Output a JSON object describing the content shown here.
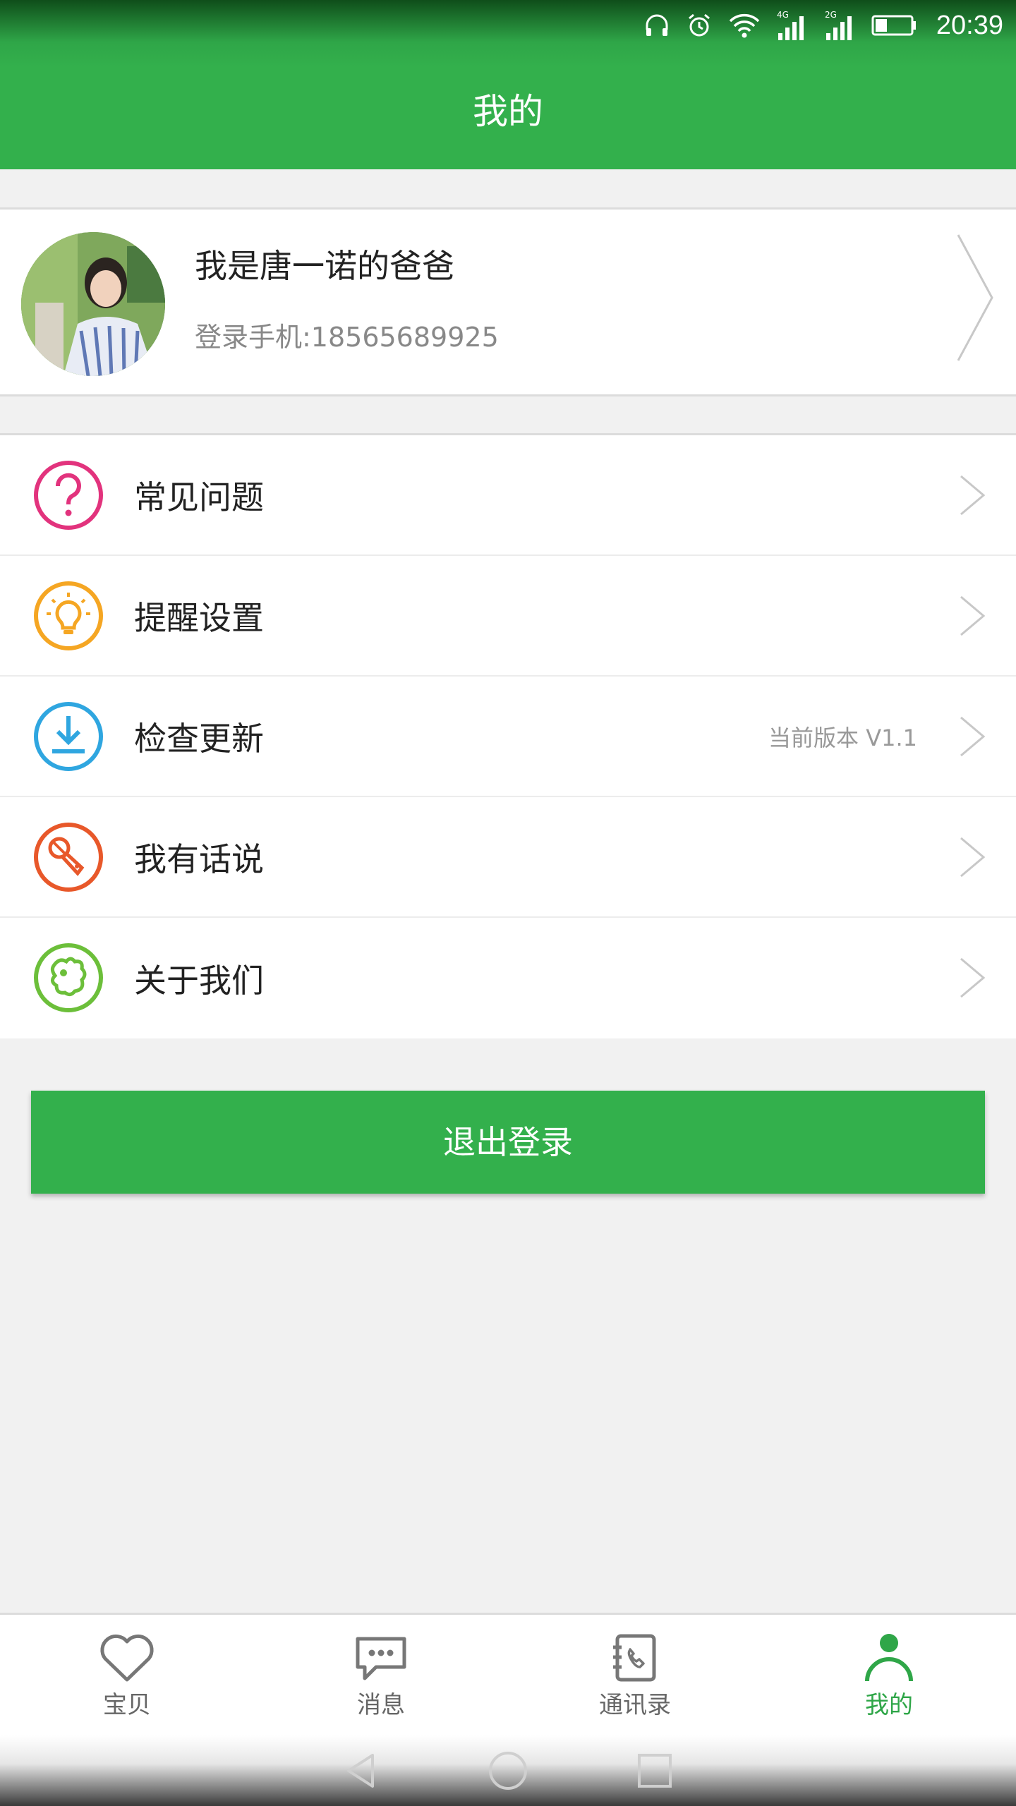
{
  "status_bar": {
    "time": "20:39",
    "icons": [
      "headphones-icon",
      "alarm-icon",
      "wifi-icon",
      "signal-4g-icon",
      "signal-2g-icon",
      "battery-icon"
    ],
    "network_labels": [
      "4G",
      "2G"
    ]
  },
  "header": {
    "title": "我的"
  },
  "profile": {
    "name": "我是唐一诺的爸爸",
    "phone": "登录手机:18565689925"
  },
  "menu": {
    "items": [
      {
        "label": "常见问题",
        "icon": "question-icon",
        "color": "#e2337d",
        "extra": ""
      },
      {
        "label": "提醒设置",
        "icon": "lightbulb-icon",
        "color": "#f5a623",
        "extra": ""
      },
      {
        "label": "检查更新",
        "icon": "download-icon",
        "color": "#2fa6e0",
        "extra": "当前版本 V1.1"
      },
      {
        "label": "我有话说",
        "icon": "microphone-icon",
        "color": "#e8582a",
        "extra": ""
      },
      {
        "label": "关于我们",
        "icon": "puzzle-icon",
        "color": "#6cbf3a",
        "extra": ""
      }
    ]
  },
  "logout": {
    "label": "退出登录"
  },
  "tabbar": {
    "tabs": [
      {
        "label": "宝贝",
        "icon": "heart-icon",
        "active": false
      },
      {
        "label": "消息",
        "icon": "chat-bubble-icon",
        "active": false
      },
      {
        "label": "通讯录",
        "icon": "contacts-book-icon",
        "active": false
      },
      {
        "label": "我的",
        "icon": "person-icon",
        "active": true
      }
    ]
  },
  "colors": {
    "brand_green": "#33b04c",
    "background": "#f1f1f1",
    "text_primary": "#222222",
    "text_secondary": "#888888"
  }
}
